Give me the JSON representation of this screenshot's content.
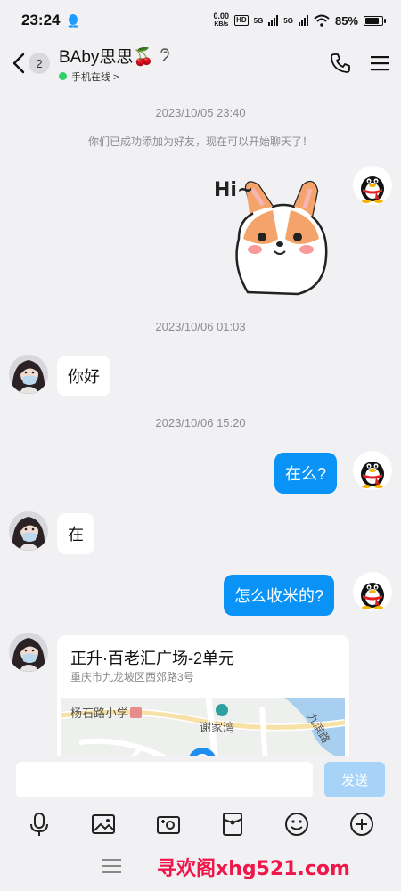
{
  "status_bar": {
    "time": "23:24",
    "net_speed_value": "0.00",
    "net_speed_unit": "KB/s",
    "hd_badge": "HD",
    "sig1_label": "5G",
    "sig2_label": "5G",
    "battery": "85%",
    "battery_level": 0.85
  },
  "header": {
    "back_badge": "2",
    "contact_name": "BAby思思🍒",
    "online_status": "手机在线 >"
  },
  "chat": {
    "timestamps": [
      "2023/10/05 23:40",
      "2023/10/06 01:03",
      "2023/10/06 15:20"
    ],
    "system_message": "你们已成功添加为好友，现在可以开始聊天了！",
    "sticker_text": "Hi~",
    "messages": {
      "in_hello": "你好",
      "out_where": "在么?",
      "in_here": "在",
      "out_how": "怎么收米的?"
    },
    "location": {
      "title": "正升·百老汇广场-2单元",
      "address": "重庆市九龙坡区西郊路3号",
      "map_label_school": "杨石路小学",
      "map_label_xiejiawan": "谢家湾",
      "map_label_road": "九滨路"
    }
  },
  "input": {
    "placeholder": "",
    "send_label": "发送"
  },
  "watermark": "寻欢阁xhg521.com",
  "colors": {
    "accent_blue": "#0a93f6",
    "send_disabled": "#a8d3f8",
    "online_green": "#2fd16a",
    "background": "#f1f1f4"
  }
}
